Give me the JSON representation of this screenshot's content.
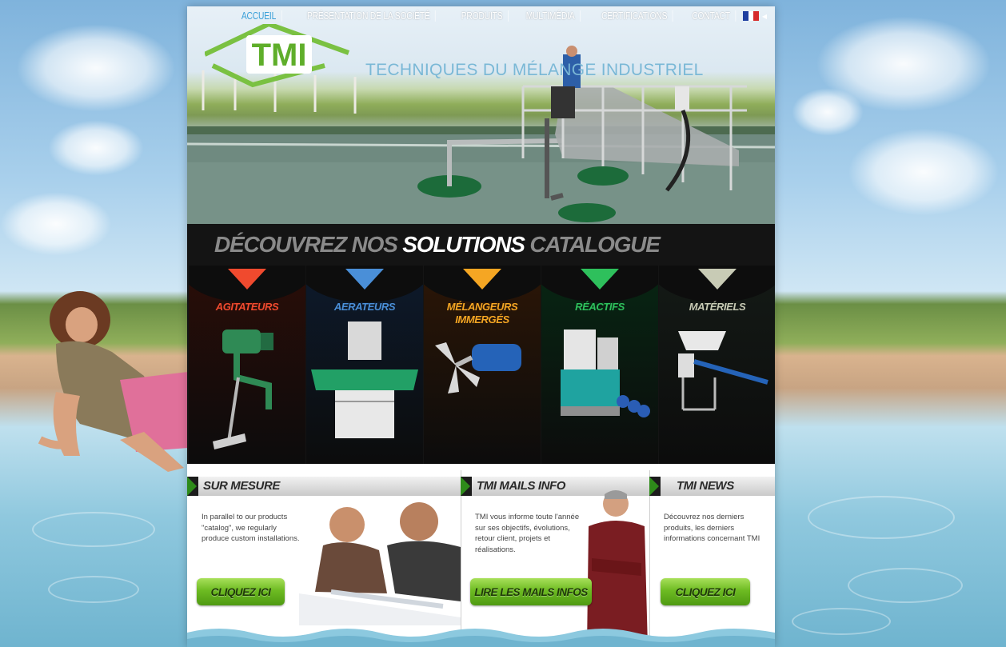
{
  "nav": {
    "items": [
      "ACCUEIL",
      "PRÉSENTATION DE LA SOCIÉTÉ",
      "PRODUITS",
      "MULTIMÉDIA",
      "CERTIFICATIONS",
      "CONTACT"
    ],
    "active_color": "#3aa0d8",
    "flag": [
      "#1f3fa0",
      "#ffffff",
      "#d62b2b"
    ]
  },
  "brand": {
    "logo_text": "TMI",
    "tagline": "TECHNIQUES DU MÉLANGE INDUSTRIEL",
    "accent": "#7ac142"
  },
  "solutions": {
    "title_pre": "DÉCOUVREZ NOS ",
    "title_bold": "SOLUTIONS",
    "title_post": " CATALOGUE",
    "categories": [
      {
        "label": "AGITATEURS",
        "color": "#f04a2e",
        "bg": "#2a0d08",
        "icon": "agitator-product"
      },
      {
        "label": "AERATEURS",
        "color": "#4a8fd8",
        "bg": "#0d1a2c",
        "icon": "aerator-product"
      },
      {
        "label": "MÉLANGEURS IMMERGÉS",
        "color": "#f5a623",
        "bg": "#2c1606",
        "icon": "submerged-mixer-product"
      },
      {
        "label": "RÉACTIFS",
        "color": "#2ec05c",
        "bg": "#072613",
        "icon": "reagent-unit-product"
      },
      {
        "label": "MATÉRIELS",
        "color": "#c8cbb5",
        "bg": "#141a16",
        "icon": "equipment-product"
      }
    ]
  },
  "panels": [
    {
      "title": "SUR MESURE",
      "text": "In parallel to our products \"catalog\", we regularly produce custom installations.",
      "button": "CLIQUEZ ICI"
    },
    {
      "title": "TMI MAILS INFO",
      "text": "TMI vous informe toute l'année sur ses objectifs, évolutions, retour client, projets et réalisations.",
      "button": "LIRE LES MAILS INFOS"
    },
    {
      "title": "TMI NEWS",
      "text": "Découvrez nos derniers produits, les derniers informations concernant TMI",
      "button": "CLIQUEZ ICI"
    }
  ]
}
